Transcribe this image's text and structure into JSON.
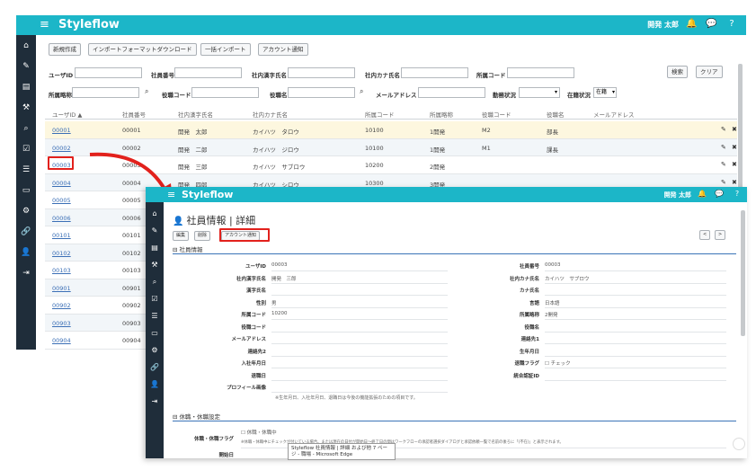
{
  "app": {
    "brand": "Styleflow",
    "menu_glyph": "≡",
    "user": "開発 太郎",
    "accent": "#1cb6c8",
    "sidebar_color": "#1f2d3a",
    "header_icons": [
      "bell-icon",
      "chat-icon",
      "help-icon"
    ]
  },
  "sidebar_icons": [
    "home-icon",
    "edit-icon",
    "book-icon",
    "tools-icon",
    "search-icon",
    "check-icon",
    "list-icon",
    "card-icon",
    "gear-icon",
    "link-icon",
    "user-icon",
    "logout-icon"
  ],
  "list": {
    "buttons": [
      "新規作成",
      "インポートフォーマットダウンロード",
      "一括インポート",
      "アカウント通知"
    ],
    "search": {
      "user_id": "ユーザID",
      "employee_no": "社員番号",
      "kanji_name": "社内漢字氏名",
      "kana_name": "社内カナ氏名",
      "dept_code": "所属コード",
      "dept_name": "所属略称",
      "title_code": "役職コード",
      "title_name": "役職名",
      "email": "メールアドレス",
      "work_status": "勤務状況",
      "enroll_status": "在籍状況",
      "enroll_value": "在籍",
      "search_button": "検索",
      "clear_button": "クリア"
    },
    "headers": [
      "ユーザID ▲",
      "社員番号",
      "社内漢字氏名",
      "社内カナ氏名",
      "所属コード",
      "所属略称",
      "役職コード",
      "役職名",
      "メールアドレス"
    ],
    "rows": [
      {
        "id": "00001",
        "no": "00001",
        "kanji": "開発　太郎",
        "kana": "カイハツ　タロウ",
        "dept": "10100",
        "dept_name": "1開発",
        "title_code": "M2",
        "title": "部長"
      },
      {
        "id": "00002",
        "no": "00002",
        "kanji": "開発　二郎",
        "kana": "カイハツ　ジロウ",
        "dept": "10100",
        "dept_name": "1開発",
        "title_code": "M1",
        "title": "課長"
      },
      {
        "id": "00003",
        "no": "00003",
        "kanji": "開発　三郎",
        "kana": "カイハツ　サブロウ",
        "dept": "10200",
        "dept_name": "2開発",
        "title_code": "",
        "title": ""
      },
      {
        "id": "00004",
        "no": "00004",
        "kanji": "開発　四郎",
        "kana": "カイハツ　シロウ",
        "dept": "10300",
        "dept_name": "3開発",
        "title_code": "",
        "title": ""
      },
      {
        "id": "00005",
        "no": "00005",
        "kanji": "",
        "kana": "",
        "dept": "",
        "dept_name": "",
        "title_code": "",
        "title": ""
      },
      {
        "id": "00006",
        "no": "00006",
        "kanji": "",
        "kana": "",
        "dept": "",
        "dept_name": "",
        "title_code": "",
        "title": ""
      },
      {
        "id": "00101",
        "no": "00101",
        "kanji": "",
        "kana": "",
        "dept": "",
        "dept_name": "",
        "title_code": "",
        "title": ""
      },
      {
        "id": "00102",
        "no": "00102",
        "kanji": "",
        "kana": "",
        "dept": "",
        "dept_name": "",
        "title_code": "",
        "title": ""
      },
      {
        "id": "00103",
        "no": "00103",
        "kanji": "",
        "kana": "",
        "dept": "",
        "dept_name": "",
        "title_code": "",
        "title": ""
      },
      {
        "id": "00901",
        "no": "00901",
        "kanji": "",
        "kana": "",
        "dept": "",
        "dept_name": "",
        "title_code": "",
        "title": ""
      },
      {
        "id": "00902",
        "no": "00902",
        "kanji": "",
        "kana": "",
        "dept": "",
        "dept_name": "",
        "title_code": "",
        "title": ""
      },
      {
        "id": "00903",
        "no": "00903",
        "kanji": "",
        "kana": "",
        "dept": "",
        "dept_name": "",
        "title_code": "",
        "title": ""
      },
      {
        "id": "00904",
        "no": "00904",
        "kanji": "",
        "kana": "",
        "dept": "",
        "dept_name": "",
        "title_code": "",
        "title": ""
      }
    ]
  },
  "detail": {
    "title": "社員情報 | 詳細",
    "buttons": [
      "編集",
      "削除",
      "アカウント通知"
    ],
    "nav_prev": "<",
    "nav_next": ">",
    "section1": "⊟ 社員情報",
    "left_fields": [
      {
        "label": "ユーザID",
        "value": "00003"
      },
      {
        "label": "社内漢字氏名",
        "value": "開発　三郎"
      },
      {
        "label": "漢字氏名",
        "value": ""
      },
      {
        "label": "性別",
        "value": "男"
      },
      {
        "label": "所属コード",
        "value": "10200"
      },
      {
        "label": "役職コード",
        "value": ""
      },
      {
        "label": "メールアドレス",
        "value": ""
      },
      {
        "label": "連絡先2",
        "value": ""
      },
      {
        "label": "入社年月日",
        "value": ""
      },
      {
        "label": "退職日",
        "value": ""
      },
      {
        "label": "プロフィール画像",
        "value": ""
      }
    ],
    "right_fields": [
      {
        "label": "社員番号",
        "value": "00003"
      },
      {
        "label": "社内カナ氏名",
        "value": "カイハツ　サブロウ"
      },
      {
        "label": "カナ氏名",
        "value": ""
      },
      {
        "label": "言語",
        "value": "日本語"
      },
      {
        "label": "所属略称",
        "value": "2開発"
      },
      {
        "label": "役職名",
        "value": ""
      },
      {
        "label": "連絡先1",
        "value": ""
      },
      {
        "label": "生年月日",
        "value": ""
      },
      {
        "label": "退職フラグ",
        "value": "☐ チェック"
      },
      {
        "label": "統合認証ID",
        "value": ""
      }
    ],
    "note1": "※生年月日、入社年月日、退職日は今後の機能拡張のための項目です。",
    "section2": "⊟ 休職・休職設定",
    "leave_label": "休職・休職フラグ",
    "leave_value": "☐ 休職・休職中",
    "leave_note": "※休職・休職中にチェックが付いている場合、または現在の日付が開始日～終了日の間はワークフローの承認者選択ダイアログと承認依頼一覧で名前の後ろに「(不在)」と表示されます。",
    "start_label": "開始日",
    "tooltip": "Styleflow 社員情報 | 詳細 および他 7 ページ - 職場 - Microsoft Edge"
  }
}
